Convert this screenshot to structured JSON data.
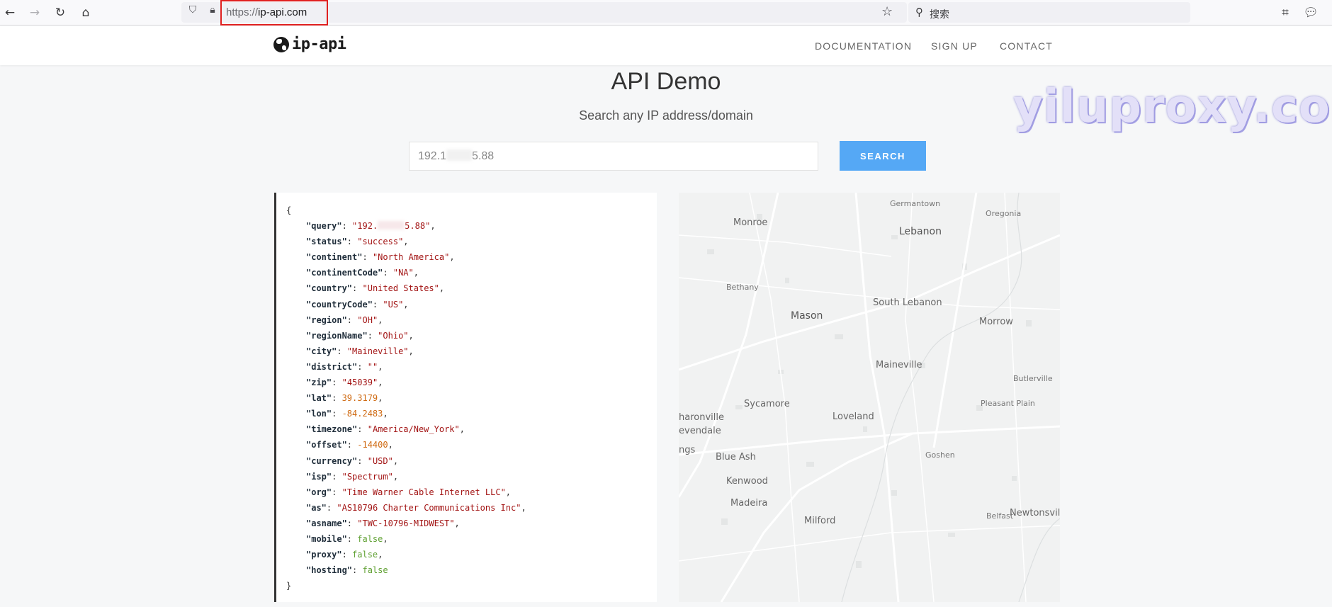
{
  "browser": {
    "url_protocol": "https://",
    "url_host": "ip-api.com",
    "search_placeholder": "搜索",
    "icons": [
      "back-icon",
      "forward-icon",
      "reload-icon",
      "home-icon",
      "shield-icon",
      "lock-icon",
      "bookmark-star-icon",
      "search-icon",
      "screenshot-icon",
      "chat-icon"
    ]
  },
  "header": {
    "logo_text": "ip-api",
    "nav": [
      "DOCUMENTATION",
      "SIGN UP",
      "CONTACT"
    ]
  },
  "main": {
    "title": "API Demo",
    "subtitle": "Search any IP address/domain",
    "ip_prefix": "192.1",
    "ip_suffix": "5.88",
    "search_label": "SEARCH"
  },
  "watermark": "yiluproxy.com",
  "json": {
    "open": "{",
    "close": "}",
    "fields": [
      {
        "key": "query",
        "value": "192.",
        "value_tail": "5.88",
        "type": "string",
        "masked": true
      },
      {
        "key": "status",
        "value": "success",
        "type": "string"
      },
      {
        "key": "continent",
        "value": "North America",
        "type": "string"
      },
      {
        "key": "continentCode",
        "value": "NA",
        "type": "string"
      },
      {
        "key": "country",
        "value": "United States",
        "type": "string"
      },
      {
        "key": "countryCode",
        "value": "US",
        "type": "string"
      },
      {
        "key": "region",
        "value": "OH",
        "type": "string"
      },
      {
        "key": "regionName",
        "value": "Ohio",
        "type": "string"
      },
      {
        "key": "city",
        "value": "Maineville",
        "type": "string"
      },
      {
        "key": "district",
        "value": "",
        "type": "string"
      },
      {
        "key": "zip",
        "value": "45039",
        "type": "string"
      },
      {
        "key": "lat",
        "value": "39.3179",
        "type": "number"
      },
      {
        "key": "lon",
        "value": "-84.2483",
        "type": "number"
      },
      {
        "key": "timezone",
        "value": "America/New_York",
        "type": "string"
      },
      {
        "key": "offset",
        "value": "-14400",
        "type": "number"
      },
      {
        "key": "currency",
        "value": "USD",
        "type": "string"
      },
      {
        "key": "isp",
        "value": "Spectrum",
        "type": "string"
      },
      {
        "key": "org",
        "value": "Time Warner Cable Internet LLC",
        "type": "string"
      },
      {
        "key": "as",
        "value": "AS10796 Charter Communications Inc",
        "type": "string"
      },
      {
        "key": "asname",
        "value": "TWC-10796-MIDWEST",
        "type": "string"
      },
      {
        "key": "mobile",
        "value": "false",
        "type": "bool"
      },
      {
        "key": "proxy",
        "value": "false",
        "type": "bool"
      },
      {
        "key": "hosting",
        "value": "false",
        "type": "bool",
        "last": true
      }
    ]
  },
  "map": {
    "labels": [
      "Germantown",
      "Oregonia",
      "Monroe",
      "Lebanon",
      "Bethany",
      "Mason",
      "South Lebanon",
      "Morrow",
      "Maineville",
      "Butlerville",
      "Sycamore",
      "Loveland",
      "Pleasant Plain",
      "haronville",
      "evendale",
      "ngs",
      "Blue Ash",
      "Goshen",
      "Kenwood",
      "Madeira",
      "Milford",
      "Belfast",
      "Newtonsville"
    ]
  }
}
